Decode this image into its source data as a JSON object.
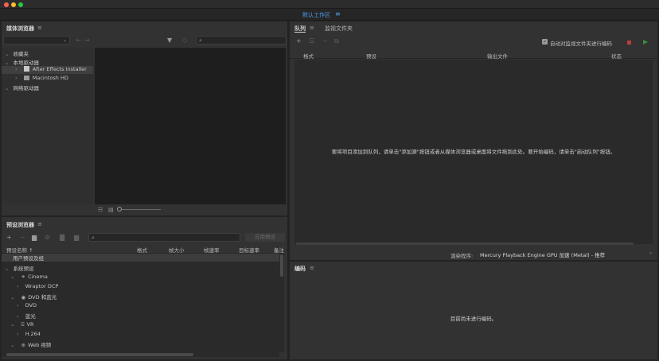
{
  "workspace": {
    "label": "默认工作区"
  },
  "media_browser": {
    "title": "媒体浏览器",
    "tree": [
      {
        "label": "收藏夹"
      },
      {
        "label": "本地驱动器"
      },
      {
        "label": "After Effects Installer"
      },
      {
        "label": "Macintosh HD"
      },
      {
        "label": "网络驱动器"
      }
    ]
  },
  "preset_browser": {
    "title": "预设浏览器",
    "apply_button": "应用预设",
    "columns": [
      "预设名称 ↑",
      "格式",
      "帧大小",
      "帧速率",
      "目标速率",
      "备注"
    ],
    "tree": [
      {
        "label": "用户预设及组"
      },
      {
        "label": "系统预设"
      },
      {
        "label": "Cinema"
      },
      {
        "label": "Wraptor DCP"
      },
      {
        "label": "DVD 和蓝光"
      },
      {
        "label": "DVD"
      },
      {
        "label": "蓝光"
      },
      {
        "label": "VR"
      },
      {
        "label": "H.264"
      },
      {
        "label": "Web 视频"
      }
    ]
  },
  "queue": {
    "tab_queue": "队列",
    "tab_watch": "监视文件夹",
    "auto_encode_label": "自动对监视文件夹进行编码",
    "auto_encode_checked": true,
    "columns": [
      "格式",
      "预设",
      "输出文件",
      "状态"
    ],
    "empty_message": "要将项目添加到队列，请单击\"添加源\"按钮或者从媒体浏览器或桌面将文件拖到此处。要开始编码，请单击\"启动队列\"按钮。",
    "renderer_label": "渲染程序:",
    "renderer_value": "Mercury Playback Engine GPU 加速 (Metal) - 推荐"
  },
  "encoding": {
    "title": "编码",
    "status": "目前尚未进行编码。"
  },
  "colors": {
    "accent_blue": "#4d9be8",
    "stop_red": "#b84040",
    "start_green": "#3c8a3c"
  }
}
